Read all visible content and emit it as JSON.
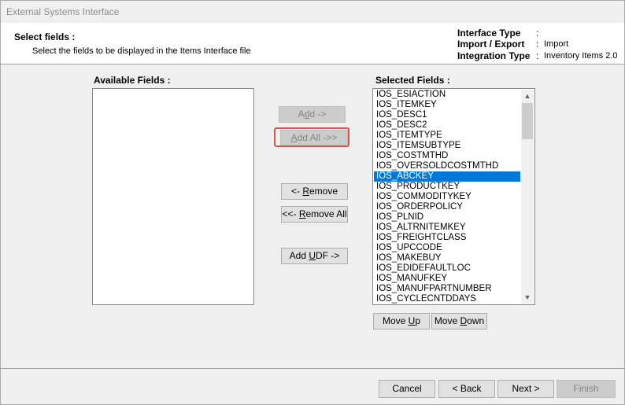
{
  "window": {
    "title": "External Systems Interface"
  },
  "header": {
    "title": "Select fields :",
    "subtitle": "Select the fields to be displayed in the Items Interface file",
    "interface_type": {
      "label": "Interface Type",
      "value": ""
    },
    "import_export": {
      "label": "Import / Export",
      "value": "Import"
    },
    "integration_type": {
      "label": "Integration Type",
      "value": "Inventory Items 2.0"
    }
  },
  "available_fields": {
    "label": "Available Fields :",
    "items": []
  },
  "selected_fields": {
    "label": "Selected Fields :",
    "items": [
      "IOS_ESIACTION",
      "IOS_ITEMKEY",
      "IOS_DESC1",
      "IOS_DESC2",
      "IOS_ITEMTYPE",
      "IOS_ITEMSUBTYPE",
      "IOS_COSTMTHD",
      "IOS_OVERSOLDCOSTMTHD",
      "IOS_ABCKEY",
      "IOS_PRODUCTKEY",
      "IOS_COMMODITYKEY",
      "IOS_ORDERPOLICY",
      "IOS_PLNID",
      "IOS_ALTRNITEMKEY",
      "IOS_FREIGHTCLASS",
      "IOS_UPCCODE",
      "IOS_MAKEBUY",
      "IOS_EDIDEFAULTLOC",
      "IOS_MANUFKEY",
      "IOS_MANUFPARTNUMBER",
      "IOS_CYCLECNTDDAYS"
    ],
    "selected_index": 8
  },
  "buttons": {
    "add": {
      "pre": "A",
      "ul": "d",
      "post": "d ->"
    },
    "add_all": {
      "pre": "",
      "ul": "A",
      "post": "dd All ->>"
    },
    "remove": {
      "pre": "<- ",
      "ul": "R",
      "post": "emove"
    },
    "remove_all": {
      "pre": "<<- ",
      "ul": "R",
      "post": "emove All"
    },
    "add_udf": {
      "pre": "Add ",
      "ul": "U",
      "post": "DF ->"
    },
    "move_up": {
      "pre": "Move ",
      "ul": "U",
      "post": "p"
    },
    "move_down": {
      "pre": "Move ",
      "ul": "D",
      "post": "own"
    },
    "cancel": "Cancel",
    "back": "< Back",
    "next": "Next >",
    "finish": "Finish"
  }
}
